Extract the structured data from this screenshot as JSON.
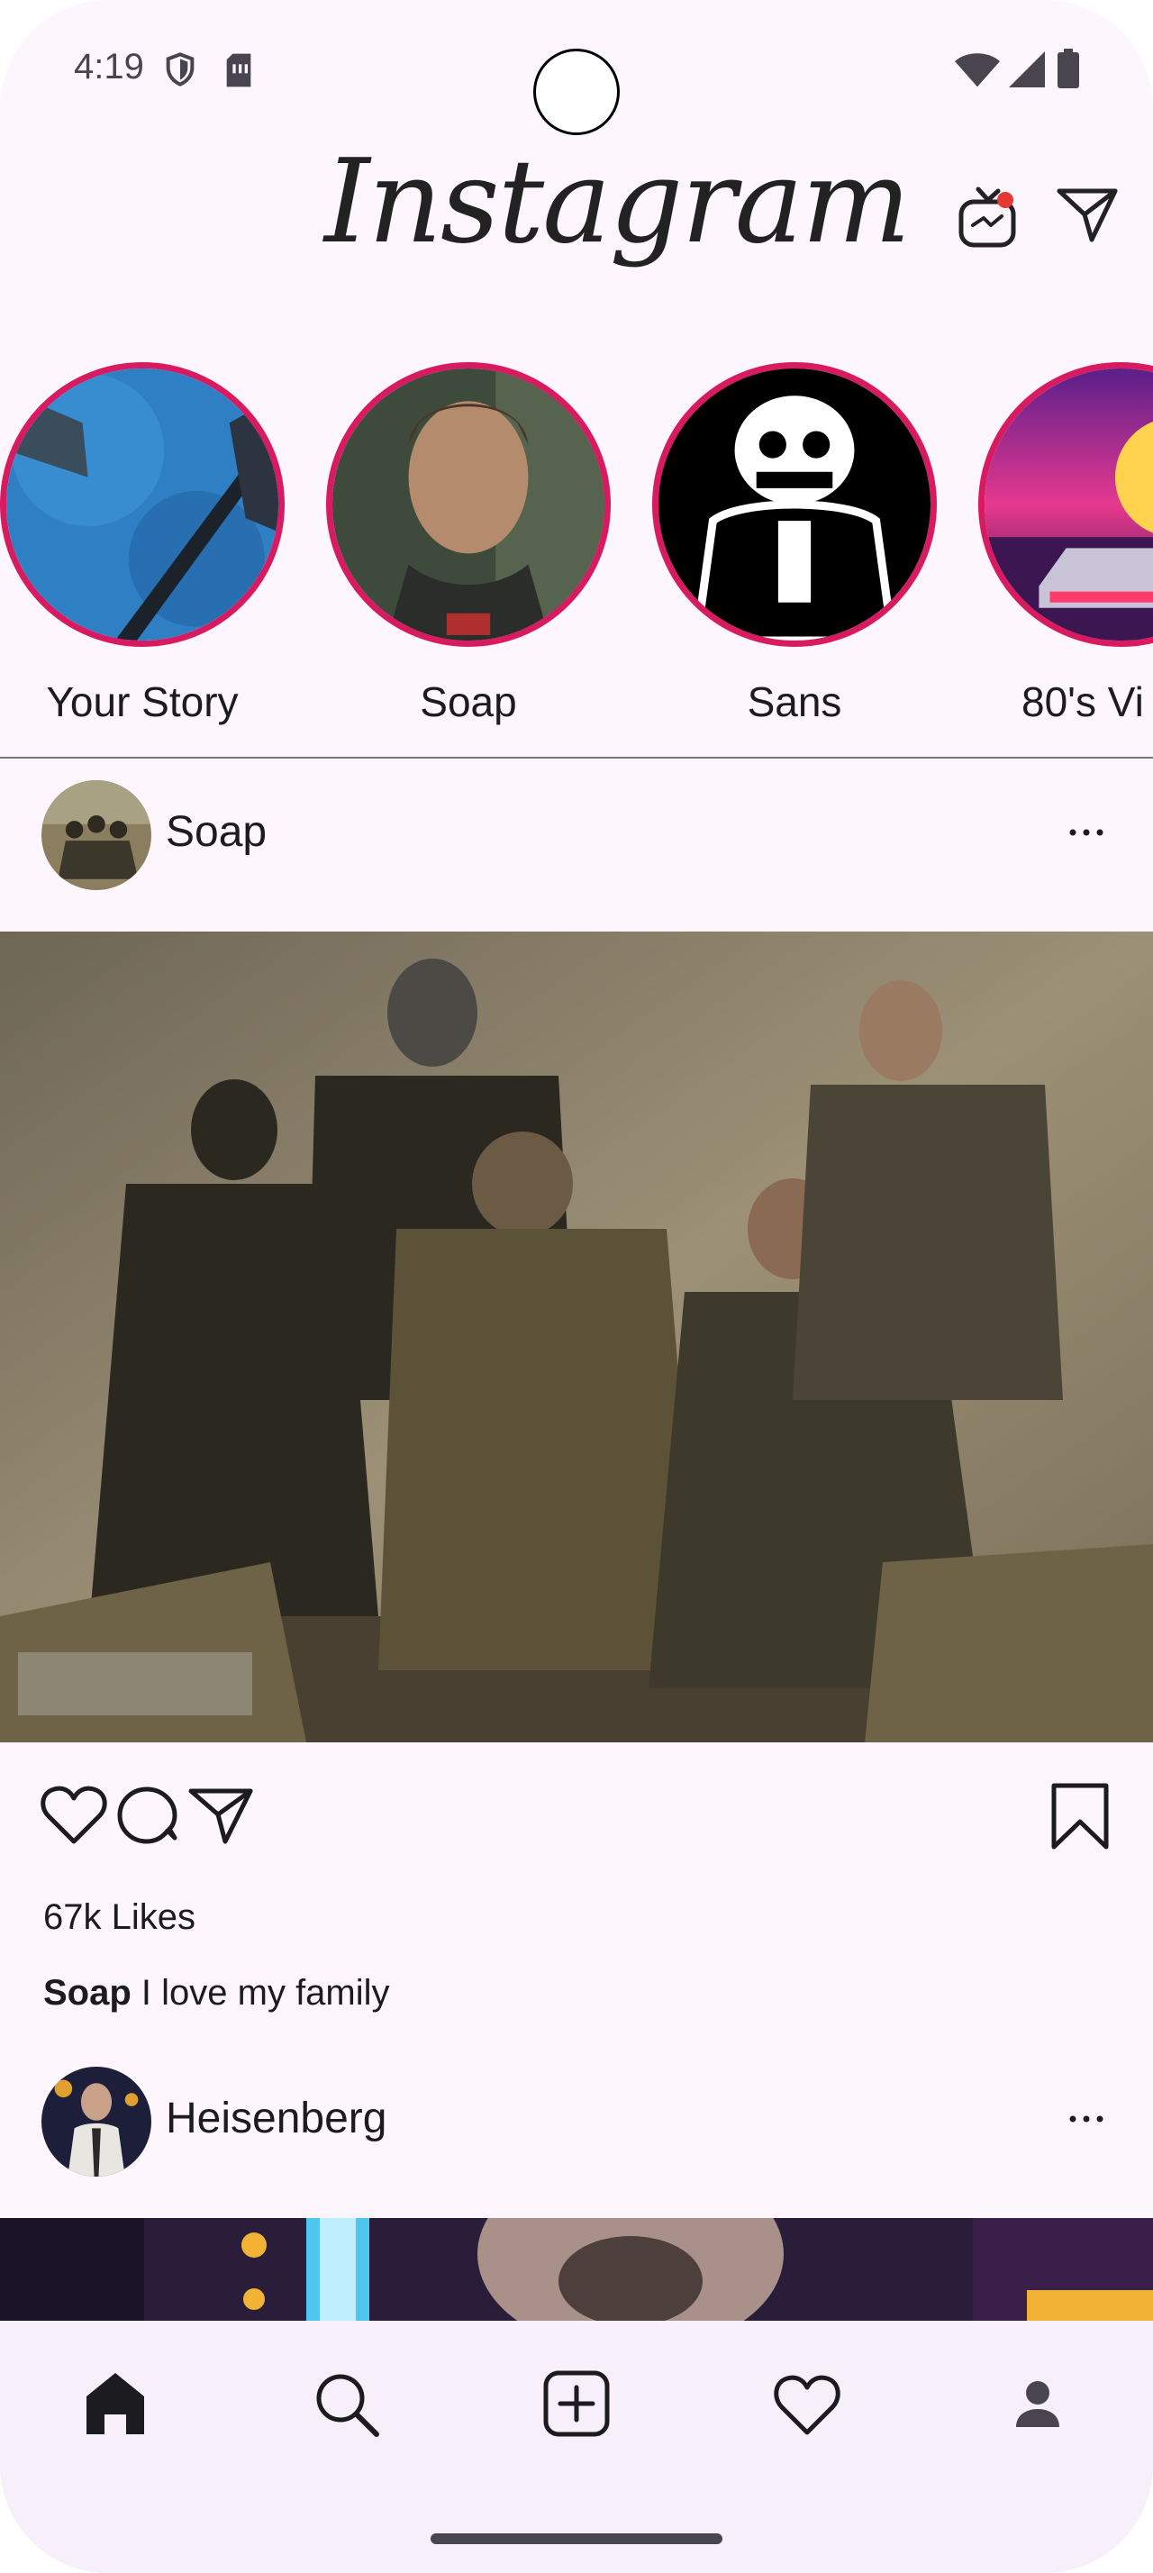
{
  "status_bar": {
    "time": "4:19"
  },
  "header": {
    "logo_text": "Instagram"
  },
  "stories": [
    {
      "label": "Your Story"
    },
    {
      "label": "Soap"
    },
    {
      "label": "Sans"
    },
    {
      "label": "80's Vi"
    }
  ],
  "posts": [
    {
      "username": "Soap",
      "likes": "67k Likes",
      "caption_user": "Soap",
      "caption_text": " I love my family"
    },
    {
      "username": "Heisenberg"
    }
  ],
  "colors": {
    "background": "#fdf6fc",
    "story_ring": "#d81b60",
    "notification_dot": "#e53935",
    "nav_background": "#f7f0fa"
  },
  "icons": [
    "shield-icon",
    "sim-icon",
    "wifi-icon",
    "signal-icon",
    "battery-icon",
    "igtv-icon",
    "direct-message-icon",
    "more-icon",
    "heart-icon",
    "comment-icon",
    "share-icon",
    "bookmark-icon",
    "home-icon",
    "search-icon",
    "add-post-icon",
    "activity-icon",
    "profile-icon"
  ]
}
